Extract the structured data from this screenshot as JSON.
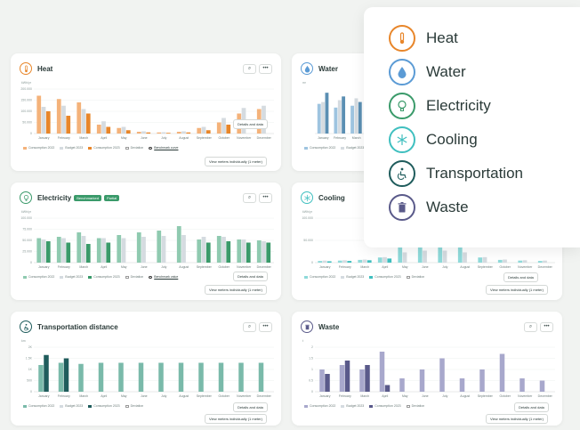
{
  "months": [
    "January",
    "February",
    "March",
    "April",
    "May",
    "June",
    "July",
    "August",
    "September",
    "October",
    "November",
    "December"
  ],
  "cards": {
    "heat": {
      "title": "Heat",
      "unit": "kWh/yr",
      "yticks": [
        "200.000",
        "150.000",
        "100.000",
        "50.000",
        "0"
      ],
      "legend": [
        "Consumption 2022",
        "Budget 2023",
        "Consumption 2023",
        "Deviation",
        "Benchmark curve"
      ],
      "details_label": "Details and data",
      "view_label": "View meters individually (1 meter)"
    },
    "water": {
      "title": "Water",
      "unit": "m³",
      "legend": [
        "Consumption 2022",
        "Budget 2023"
      ],
      "details_label": "Details and data"
    },
    "electricity": {
      "title": "Electricity",
      "badges": [
        "Benchmarked",
        "Partial"
      ],
      "unit": "kWh/yr",
      "yticks": [
        "100.000",
        "75.000",
        "50.000",
        "25.000",
        "0"
      ],
      "legend": [
        "Consumption 2022",
        "Budget 2023",
        "Consumption 2023",
        "Deviation",
        "Benchmark value"
      ],
      "details_label": "Details and data",
      "view_label": "View meters individually (1 meter)"
    },
    "cooling": {
      "title": "Cooling",
      "unit": "kWh/yr",
      "yticks": [
        "100.000",
        "50.000",
        "0"
      ],
      "legend": [
        "Consumption 2022",
        "Budget 2023",
        "Consumption 2023",
        "Deviation"
      ],
      "details_label": "Details and data",
      "view_label": "View meters individually (1 meter)"
    },
    "transport": {
      "title": "Transportation distance",
      "unit": "km",
      "yticks": [
        "2K",
        "1.5K",
        "1K",
        "500",
        "0"
      ],
      "legend": [
        "Consumption 2022",
        "Budget 2023",
        "Consumption 2023",
        "Deviation"
      ],
      "details_label": "Details and data",
      "view_label": "View meters individually (1 meter)"
    },
    "waste": {
      "title": "Waste",
      "unit": "t",
      "yticks": [
        "2",
        "1.5",
        "1",
        "0.5",
        "0"
      ],
      "legend": [
        "Consumption 2022",
        "Budget 2023",
        "Consumption 2023",
        "Deviation"
      ],
      "details_label": "Details and data",
      "view_label": "View meters individually (1 meter)"
    }
  },
  "categories": [
    {
      "label": "Heat",
      "icon": "thermometer-icon",
      "color": "#e8862a"
    },
    {
      "label": "Water",
      "icon": "water-drop-icon",
      "color": "#5b9bd5"
    },
    {
      "label": "Electricity",
      "icon": "lightbulb-icon",
      "color": "#3a9a6a"
    },
    {
      "label": "Cooling",
      "icon": "snowflake-icon",
      "color": "#3fbfbf"
    },
    {
      "label": "Transportation",
      "icon": "wheelchair-icon",
      "color": "#1f5c5c"
    },
    {
      "label": "Waste",
      "icon": "trash-icon",
      "color": "#5a5a8a"
    }
  ],
  "chart_data": [
    {
      "type": "bar",
      "name": "heat",
      "ylim": [
        0,
        200000
      ],
      "categories": [
        "January",
        "February",
        "March",
        "April",
        "May",
        "June",
        "July",
        "August",
        "September",
        "October",
        "November",
        "December"
      ],
      "series": [
        {
          "name": "Consumption 2022",
          "color": "#f4b27a",
          "values": [
            170000,
            155000,
            140000,
            40000,
            25000,
            8000,
            5000,
            8000,
            25000,
            50000,
            90000,
            110000
          ]
        },
        {
          "name": "Budget 2023",
          "color": "#d5dbe0",
          "values": [
            120000,
            125000,
            110000,
            55000,
            30000,
            10000,
            6000,
            10000,
            30000,
            70000,
            115000,
            125000
          ]
        },
        {
          "name": "Consumption 2023",
          "color": "#e8862a",
          "values": [
            100000,
            80000,
            90000,
            30000,
            15000,
            5000,
            3000,
            5000,
            15000,
            40000,
            0,
            0
          ]
        }
      ]
    },
    {
      "type": "bar",
      "name": "water",
      "ylim": [
        0,
        120
      ],
      "categories": [
        "January",
        "February",
        "March"
      ],
      "series": [
        {
          "name": "Consumption 2022",
          "color": "#9ec4e0",
          "values": [
            80,
            70,
            75
          ]
        },
        {
          "name": "Budget 2023",
          "color": "#d5dbe0",
          "values": [
            85,
            90,
            95
          ]
        },
        {
          "name": "Consumption 2023",
          "color": "#5b8fb3",
          "values": [
            110,
            100,
            85
          ]
        }
      ]
    },
    {
      "type": "bar",
      "name": "electricity",
      "ylim": [
        0,
        100000
      ],
      "categories": [
        "January",
        "February",
        "March",
        "April",
        "May",
        "June",
        "July",
        "August",
        "September",
        "October",
        "November",
        "December"
      ],
      "series": [
        {
          "name": "Consumption 2022",
          "color": "#8fcab0",
          "values": [
            55000,
            58000,
            68000,
            55000,
            62000,
            68000,
            72000,
            82000,
            52000,
            60000,
            52000,
            50000
          ]
        },
        {
          "name": "Budget 2023",
          "color": "#d5dbe0",
          "values": [
            52000,
            55000,
            60000,
            55000,
            55000,
            58000,
            60000,
            62000,
            58000,
            58000,
            52000,
            48000
          ]
        },
        {
          "name": "Consumption 2023",
          "color": "#3a9a6a",
          "values": [
            48000,
            45000,
            42000,
            45000,
            0,
            0,
            0,
            0,
            45000,
            48000,
            45000,
            45000
          ]
        }
      ]
    },
    {
      "type": "bar",
      "name": "cooling",
      "ylim": [
        0,
        130000
      ],
      "categories": [
        "January",
        "February",
        "March",
        "April",
        "May",
        "June",
        "July",
        "August",
        "September",
        "October",
        "November",
        "December"
      ],
      "series": [
        {
          "name": "Consumption 2022",
          "color": "#8fdada",
          "values": [
            5000,
            6000,
            8000,
            15000,
            50000,
            60000,
            58000,
            52000,
            15000,
            8000,
            6000,
            5000
          ]
        },
        {
          "name": "Budget 2023",
          "color": "#d5dbe0",
          "values": [
            6000,
            7000,
            9000,
            16000,
            30000,
            35000,
            35000,
            30000,
            16000,
            9000,
            7000,
            6000
          ]
        },
        {
          "name": "Consumption 2023",
          "color": "#3fbfbf",
          "values": [
            4000,
            5000,
            7000,
            12000,
            0,
            0,
            0,
            0,
            0,
            0,
            0,
            0
          ]
        }
      ]
    },
    {
      "type": "bar",
      "name": "transportation",
      "ylim": [
        0,
        2000
      ],
      "categories": [
        "January",
        "February",
        "March",
        "April",
        "May",
        "June",
        "July",
        "August",
        "September",
        "October",
        "November",
        "December"
      ],
      "series": [
        {
          "name": "Consumption 2022",
          "color": "#7abaaa",
          "values": [
            1200,
            1300,
            1250,
            1300,
            1300,
            1300,
            1300,
            1300,
            1300,
            1300,
            1300,
            1300
          ]
        },
        {
          "name": "Consumption 2023",
          "color": "#1f5c5c",
          "values": [
            1650,
            1500,
            0,
            0,
            0,
            0,
            0,
            0,
            0,
            0,
            0,
            0
          ]
        }
      ]
    },
    {
      "type": "bar",
      "name": "waste",
      "ylim": [
        0,
        2
      ],
      "categories": [
        "January",
        "February",
        "March",
        "April",
        "May",
        "June",
        "July",
        "August",
        "September",
        "October",
        "November",
        "December"
      ],
      "series": [
        {
          "name": "Consumption 2022",
          "color": "#a8a8cc",
          "values": [
            1.0,
            1.2,
            1.0,
            1.8,
            0.6,
            1.0,
            1.5,
            0.6,
            1.0,
            1.7,
            0.6,
            0.5
          ]
        },
        {
          "name": "Consumption 2023",
          "color": "#5a5a8a",
          "values": [
            0.8,
            1.4,
            1.2,
            0.3,
            0,
            0,
            0,
            0,
            0,
            0,
            0,
            0
          ]
        }
      ]
    }
  ]
}
